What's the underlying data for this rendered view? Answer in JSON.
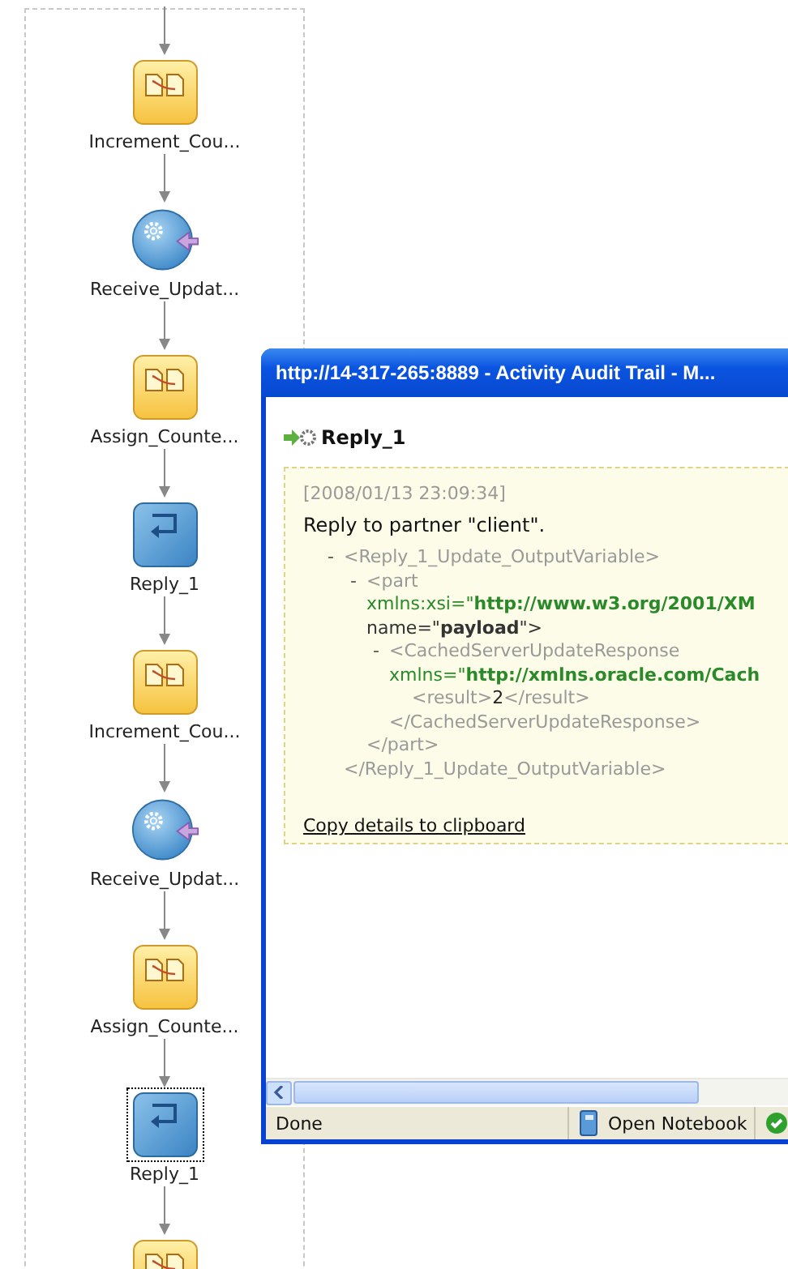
{
  "flow": {
    "nodes": [
      {
        "kind": "assign",
        "label": "Increment_Cou...",
        "selected": false
      },
      {
        "kind": "receive",
        "label": "Receive_Updat...",
        "selected": false
      },
      {
        "kind": "assign",
        "label": "Assign_Counte...",
        "selected": false
      },
      {
        "kind": "reply",
        "label": "Reply_1",
        "selected": false
      },
      {
        "kind": "assign",
        "label": "Increment_Cou...",
        "selected": false
      },
      {
        "kind": "receive",
        "label": "Receive_Updat...",
        "selected": false
      },
      {
        "kind": "assign",
        "label": "Assign_Counte...",
        "selected": false
      },
      {
        "kind": "reply",
        "label": "Reply_1",
        "selected": true
      },
      {
        "kind": "assign",
        "selected": false
      }
    ]
  },
  "window": {
    "title": "http://14-317-265:8889 - Activity Audit Trail - M...",
    "heading": "Reply_1",
    "details": {
      "timestamp": "[2008/01/13 23:09:34]",
      "message": "Reply to partner \"client\".",
      "xml": {
        "toggle": "-",
        "open": "<Reply_1_Update_OutputVariable>",
        "close": "</Reply_1_Update_OutputVariable>",
        "children": [
          {
            "toggle": "-",
            "open": "<part",
            "attributes": [
              {
                "text": "xmlns:xsi=\"**http://www.w3.org/2001/XM**",
                "color": "#2a8a2a"
              },
              {
                "text": "name=\"**payload**\">",
                "color": "#333333"
              }
            ],
            "close": "</part>",
            "children": [
              {
                "toggle": "-",
                "open": "<CachedServerUpdateResponse",
                "attributes": [
                  {
                    "text": "xmlns=\"**http://xmlns.oracle.com/Cach**",
                    "color": "#2a8a2a"
                  }
                ],
                "close": "</CachedServerUpdateResponse>",
                "children": [
                  {
                    "open": "<result>",
                    "value": "2",
                    "close": "</result>"
                  }
                ]
              }
            ]
          }
        ]
      },
      "copy_link": "Copy details to clipboard"
    },
    "status_bar": {
      "status": "Done",
      "notebook": "Open Notebook"
    }
  }
}
